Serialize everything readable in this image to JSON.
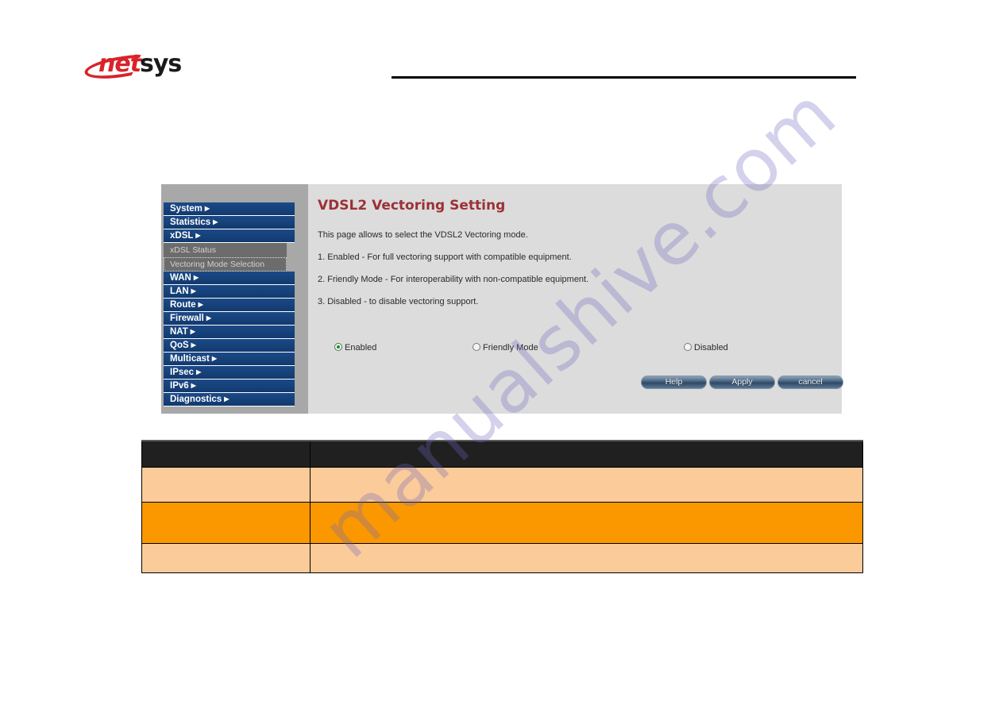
{
  "document": {
    "brand": {
      "logo_primary": "net",
      "logo_secondary": "sys",
      "primary_color": "#d8232a",
      "secondary_color": "#1a1a1a",
      "swoosh_icon": "red-swoosh-icon"
    },
    "watermark_text": "manualshive.com",
    "watermark_color": "#6c68be"
  },
  "router_ui": {
    "sidebar": {
      "background_color": "#a8a8a8",
      "menu_color": "#17437c",
      "items": [
        {
          "label": "System",
          "caret": "▶",
          "expanded": false
        },
        {
          "label": "Statistics",
          "caret": "▶",
          "expanded": false
        },
        {
          "label": "xDSL",
          "caret": "▶",
          "expanded": true
        },
        {
          "label": "WAN",
          "caret": "▶",
          "expanded": false
        },
        {
          "label": "LAN",
          "caret": "▶",
          "expanded": false
        },
        {
          "label": "Route",
          "caret": "▶",
          "expanded": false
        },
        {
          "label": "Firewall",
          "caret": "▶",
          "expanded": false
        },
        {
          "label": "NAT",
          "caret": "▶",
          "expanded": false
        },
        {
          "label": "QoS",
          "caret": "▶",
          "expanded": false
        },
        {
          "label": "Multicast",
          "caret": "▶",
          "expanded": false
        },
        {
          "label": "IPsec",
          "caret": "▶",
          "expanded": false
        },
        {
          "label": "IPv6",
          "caret": "▶",
          "expanded": false
        },
        {
          "label": "Diagnostics",
          "caret": "▶",
          "expanded": false
        }
      ],
      "submenu": {
        "parent": "xDSL",
        "background_color": "#6c6c6c",
        "items": [
          {
            "label": "xDSL Status",
            "focused": false
          },
          {
            "label": "Vectoring Mode Selection",
            "focused": true
          }
        ]
      }
    },
    "content": {
      "background_color": "#dcdcdc",
      "title": "VDSL2 Vectoring Setting",
      "title_color": "#9b3136",
      "intro": "This page allows to select the VDSL2 Vectoring mode.",
      "bullets": [
        "1. Enabled - For full vectoring support with compatible equipment.",
        "2. Friendly Mode - For interoperability with non-compatible equipment.",
        "3. Disabled - to disable vectoring support."
      ],
      "radio_group": {
        "name": "vectoring-mode",
        "selected": "Enabled",
        "options": [
          {
            "label": "Enabled",
            "checked": true
          },
          {
            "label": "Friendly Mode",
            "checked": false
          },
          {
            "label": "Disabled",
            "checked": false
          }
        ]
      },
      "buttons": [
        {
          "label": "Help"
        },
        {
          "label": "Apply"
        },
        {
          "label": "cancel"
        }
      ]
    }
  },
  "description_table": {
    "header_color": "#202020",
    "light_row_color": "#fbcb99",
    "dark_row_color": "#fb9800",
    "columns": [
      "",
      ""
    ],
    "rows": [
      {
        "style": "header",
        "cells": [
          "",
          ""
        ]
      },
      {
        "style": "light",
        "cells": [
          "",
          ""
        ]
      },
      {
        "style": "dark",
        "cells": [
          "",
          ""
        ]
      },
      {
        "style": "light",
        "cells": [
          "",
          ""
        ]
      }
    ]
  }
}
